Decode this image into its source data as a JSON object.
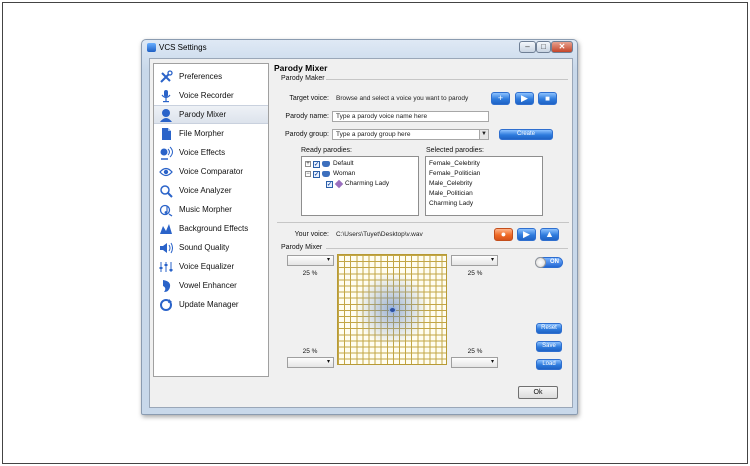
{
  "window": {
    "title": "VCS Settings",
    "controls": {
      "minimize": "–",
      "maximize": "□",
      "close": "✕"
    }
  },
  "sidebar": {
    "items": [
      {
        "label": "Preferences",
        "icon": "tools-icon"
      },
      {
        "label": "Voice Recorder",
        "icon": "microphone-icon"
      },
      {
        "label": "Parody Mixer",
        "icon": "parody-mixer-icon"
      },
      {
        "label": "File Morpher",
        "icon": "file-morpher-icon"
      },
      {
        "label": "Voice Effects",
        "icon": "voice-effects-icon"
      },
      {
        "label": "Voice Comparator",
        "icon": "voice-comparator-icon"
      },
      {
        "label": "Voice Analyzer",
        "icon": "voice-analyzer-icon"
      },
      {
        "label": "Music Morpher",
        "icon": "music-morpher-icon"
      },
      {
        "label": "Background Effects",
        "icon": "background-effects-icon"
      },
      {
        "label": "Sound Quality",
        "icon": "sound-quality-icon"
      },
      {
        "label": "Voice Equalizer",
        "icon": "voice-equalizer-icon"
      },
      {
        "label": "Vowel Enhancer",
        "icon": "vowel-enhancer-icon"
      },
      {
        "label": "Update Manager",
        "icon": "update-manager-icon"
      }
    ],
    "active_index": 2
  },
  "panel": {
    "title": "Parody Mixer",
    "maker_group": "Parody Maker",
    "target_voice": {
      "label": "Target voice:",
      "value": "Browse and select a voice you want to parody"
    },
    "parody_name": {
      "label": "Parody name:",
      "placeholder": "Type a parody voice name here"
    },
    "parody_group": {
      "label": "Parody group:",
      "placeholder": "Type a parody group here",
      "arrow": "▼"
    },
    "create_button": "Create",
    "ready_parodies": {
      "label": "Ready parodies:",
      "tree": [
        {
          "label": "Default",
          "expander": "+",
          "checked": true
        },
        {
          "label": "Woman",
          "expander": "−",
          "checked": true
        },
        {
          "label": "Charming Lady",
          "checked": true
        }
      ]
    },
    "selected_parodies": {
      "label": "Selected parodies:",
      "items": [
        "Female_Celebrity",
        "Female_Politician",
        "Male_Celebrity",
        "Male_Politician",
        "Charming Lady"
      ]
    },
    "your_voice": {
      "label": "Your voice:",
      "value": "C:\\Users\\Tuyet\\Desktop\\v.wav"
    },
    "mixer_group": "Parody Mixer",
    "mixer": {
      "top_left_pct": "25 %",
      "top_right_pct": "25 %",
      "bottom_left_pct": "25 %",
      "bottom_right_pct": "25 %",
      "toggle": "ON",
      "reset": "Reset",
      "save": "Save",
      "load": "Load"
    },
    "ok": "Ok"
  },
  "icons": {
    "add": "+",
    "play": "▶",
    "stop": "■",
    "record": "●",
    "upload": "▲"
  }
}
